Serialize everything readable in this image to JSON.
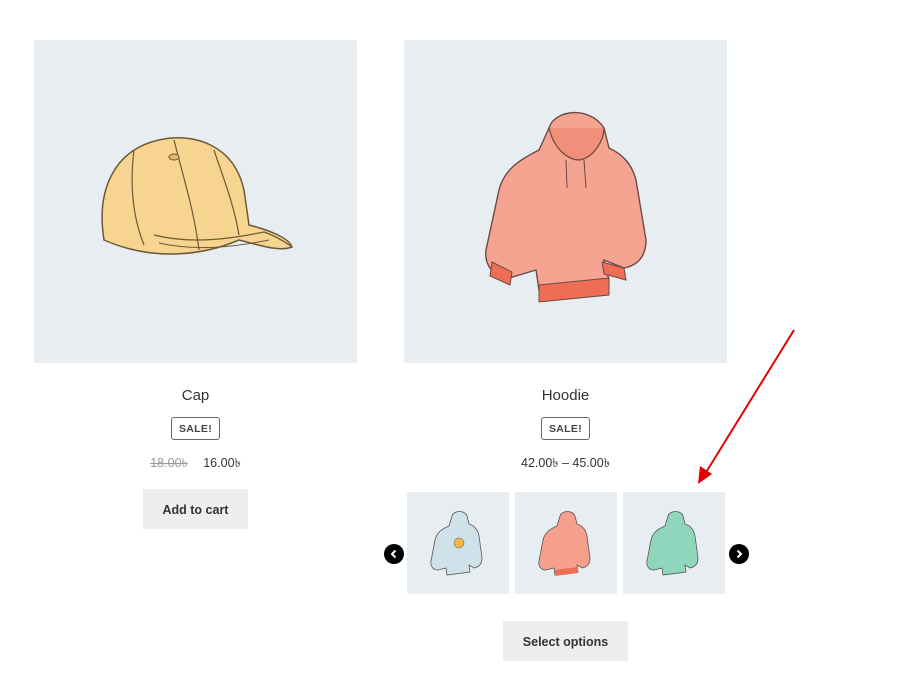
{
  "products": [
    {
      "name": "Cap",
      "sale_badge": "SALE!",
      "old_price": "18.00৳",
      "price": "16.00৳",
      "button_label": "Add to cart"
    },
    {
      "name": "Hoodie",
      "sale_badge": "SALE!",
      "price_range": "42.00৳ – 45.00৳",
      "button_label": "Select options",
      "swatches": [
        {
          "color_name": "blue",
          "color": "#cfe2ea"
        },
        {
          "color_name": "pink",
          "color": "#f4a08d"
        },
        {
          "color_name": "green",
          "color": "#8fd6bd"
        }
      ]
    }
  ],
  "colors": {
    "image_bg": "#e8edf2",
    "button_bg": "#eeeeee",
    "annotation_arrow": "#e30000"
  },
  "icons": {
    "prev": "chevron-left-circle-icon",
    "next": "chevron-right-circle-icon"
  }
}
